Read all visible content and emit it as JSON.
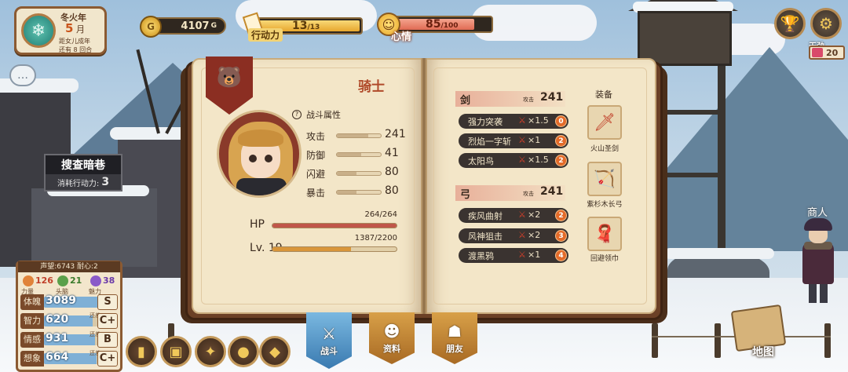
{
  "calendar": {
    "year": "冬火年",
    "month_num": "5",
    "month_unit": "月",
    "line1": "距女儿成年",
    "line2": "还有 8 回合"
  },
  "resources": {
    "gold_value": "4107",
    "gold_unit": "G",
    "ap_label": "行动力",
    "ap_current": "13",
    "ap_max": "/13",
    "ap_fraction": 1.0,
    "mood_label": "心情",
    "mood_current": "85",
    "mood_max": "/100",
    "mood_fraction": 0.85
  },
  "top_right": {
    "ganbing_label": "干劲",
    "ganbing_value": "20"
  },
  "task": {
    "title": "搜查暗巷",
    "cost_label": "消耗行动力:",
    "cost_value": "3"
  },
  "stats": {
    "fame": "声望:6743  耐心:2",
    "triple": [
      {
        "value": "126",
        "label": "力量",
        "color": "#e0833a"
      },
      {
        "value": "21",
        "label": "头脑",
        "color": "#5aa04a"
      },
      {
        "value": "38",
        "label": "魅力",
        "color": "#8a5ac8"
      }
    ],
    "rows": [
      {
        "name": "体魄",
        "value": "3089",
        "sub": "",
        "grade": "S",
        "fill": 1.0
      },
      {
        "name": "智力",
        "value": "620",
        "sub": "还差 80",
        "grade": "C+",
        "fill": 0.88
      },
      {
        "name": "情感",
        "value": "931",
        "sub": "还差 ",
        "grade": "B",
        "fill": 0.93
      },
      {
        "name": "想象",
        "value": "664",
        "sub": "还差 36",
        "grade": "C+",
        "fill": 0.95
      }
    ]
  },
  "book": {
    "class_title": "骑士",
    "section_title": "战斗属性",
    "attributes": [
      {
        "name": "攻击",
        "value": "241",
        "fill": 0.72
      },
      {
        "name": "防御",
        "value": "41",
        "fill": 0.55
      },
      {
        "name": "闪避",
        "value": "80",
        "fill": 0.45
      },
      {
        "name": "暴击",
        "value": "80",
        "fill": 0.45
      }
    ],
    "hp": {
      "label": "HP",
      "current": "264/264",
      "fraction": 1.0,
      "color": "#c0574a"
    },
    "level": {
      "label": "Lv. 19",
      "current": "1387/2200",
      "fraction": 0.63,
      "color": "#d9963a"
    },
    "weapons": [
      {
        "name": "剑",
        "tag": "攻击",
        "value": "241",
        "skills": [
          {
            "name": "强力突袭",
            "mult": "×1.5",
            "level": "0"
          },
          {
            "name": "烈焰一字斩",
            "mult": "×1",
            "level": "2"
          },
          {
            "name": "太阳鸟",
            "mult": "×1.5",
            "level": "2"
          }
        ]
      },
      {
        "name": "弓",
        "tag": "攻击",
        "value": "241",
        "skills": [
          {
            "name": "疾风曲射",
            "mult": "×2",
            "level": "2"
          },
          {
            "name": "风神狙击",
            "mult": "×2",
            "level": "3"
          },
          {
            "name": "渡黑鸦",
            "mult": "×1",
            "level": "4"
          }
        ]
      }
    ],
    "equip_header": "装备",
    "equipment": [
      {
        "name": "火山圣剑",
        "icon": "sword-icon"
      },
      {
        "name": "紫杉木长弓",
        "icon": "bow-icon"
      },
      {
        "name": "回避领巾",
        "icon": "scarf-icon"
      }
    ]
  },
  "tabs": [
    {
      "label": "战斗",
      "icon": "crossed-swords-icon",
      "active": true
    },
    {
      "label": "资料",
      "icon": "girl-portrait-icon",
      "active": false
    },
    {
      "label": "朋友",
      "icon": "friend-silhouette-icon",
      "active": false
    }
  ],
  "map_label": "地图",
  "merchant_label": "商人"
}
